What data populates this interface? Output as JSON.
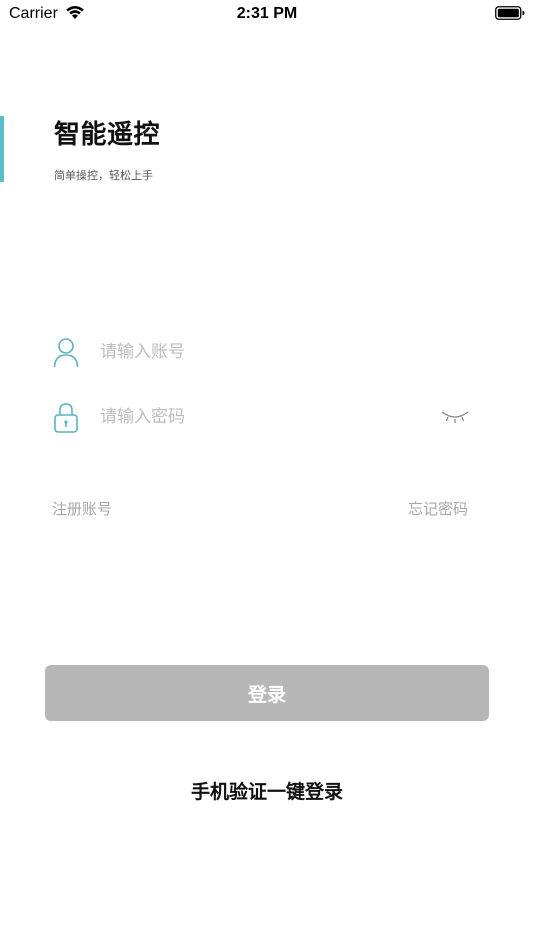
{
  "status_bar": {
    "carrier": "Carrier",
    "time": "2:31 PM",
    "icons": [
      "wifi-icon",
      "battery-icon"
    ]
  },
  "header": {
    "title": "智能遥控",
    "subtitle": "简单操控，轻松上手",
    "accent_color": "#5bbfc9"
  },
  "form": {
    "account": {
      "placeholder": "请输入账号",
      "value": "",
      "icon": "user-icon"
    },
    "password": {
      "placeholder": "请输入密码",
      "value": "",
      "icon": "lock-icon",
      "toggle_icon": "eye-closed-icon"
    },
    "register_label": "注册账号",
    "forgot_label": "忘记密码",
    "login_label": "登录",
    "login_button_color": "#b7b7b7"
  },
  "alt_login": {
    "label": "手机验证一键登录"
  }
}
